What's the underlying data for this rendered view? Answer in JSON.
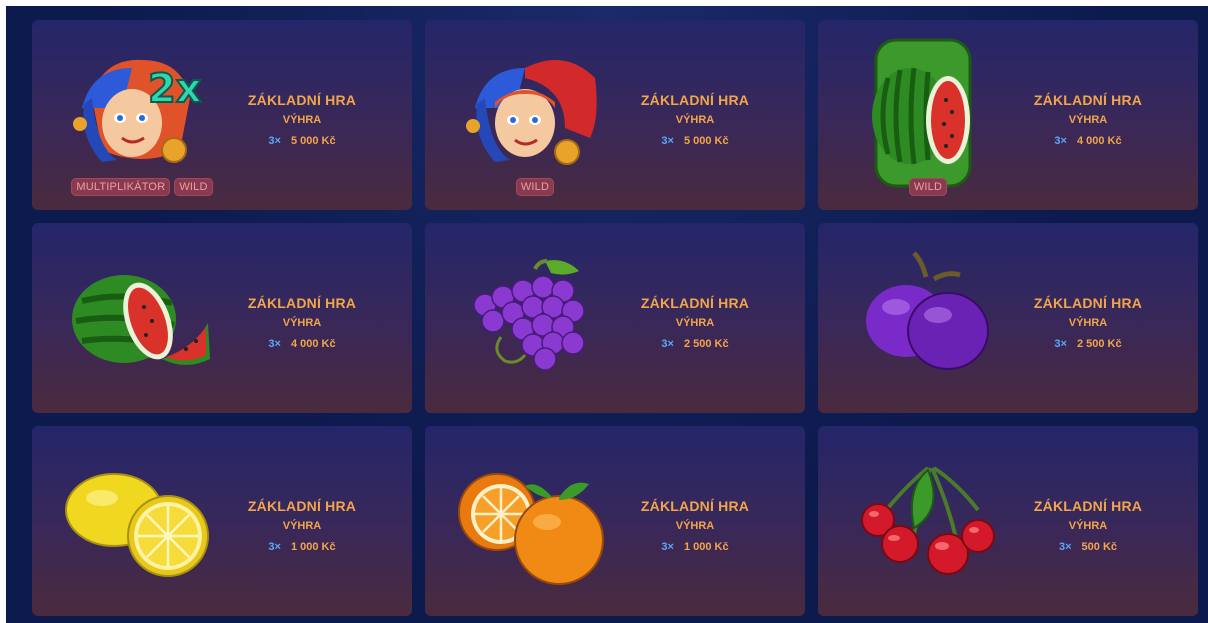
{
  "cards": [
    {
      "symbol": "jester-2x-icon",
      "tags": [
        "MULTIPLIKÁTOR",
        "WILD"
      ],
      "title": "ZÁKLADNÍ HRA",
      "subtitle": "VÝHRA",
      "multiplier": "3×",
      "amount": "5 000 Kč"
    },
    {
      "symbol": "jester-icon",
      "tags": [
        "WILD"
      ],
      "title": "ZÁKLADNÍ HRA",
      "subtitle": "VÝHRA",
      "multiplier": "3×",
      "amount": "5 000 Kč"
    },
    {
      "symbol": "watermelon-wild-icon",
      "tags": [
        "WILD"
      ],
      "title": "ZÁKLADNÍ HRA",
      "subtitle": "VÝHRA",
      "multiplier": "3×",
      "amount": "4 000 Kč"
    },
    {
      "symbol": "watermelon-icon",
      "tags": [],
      "title": "ZÁKLADNÍ HRA",
      "subtitle": "VÝHRA",
      "multiplier": "3×",
      "amount": "4 000 Kč"
    },
    {
      "symbol": "grapes-icon",
      "tags": [],
      "title": "ZÁKLADNÍ HRA",
      "subtitle": "VÝHRA",
      "multiplier": "3×",
      "amount": "2 500 Kč"
    },
    {
      "symbol": "plum-icon",
      "tags": [],
      "title": "ZÁKLADNÍ HRA",
      "subtitle": "VÝHRA",
      "multiplier": "3×",
      "amount": "2 500 Kč"
    },
    {
      "symbol": "lemon-icon",
      "tags": [],
      "title": "ZÁKLADNÍ HRA",
      "subtitle": "VÝHRA",
      "multiplier": "3×",
      "amount": "1 000 Kč"
    },
    {
      "symbol": "orange-icon",
      "tags": [],
      "title": "ZÁKLADNÍ HRA",
      "subtitle": "VÝHRA",
      "multiplier": "3×",
      "amount": "1 000 Kč"
    },
    {
      "symbol": "cherry-icon",
      "tags": [],
      "title": "ZÁKLADNÍ HRA",
      "subtitle": "VÝHRA",
      "multiplier": "3×",
      "amount": "500 Kč"
    }
  ]
}
